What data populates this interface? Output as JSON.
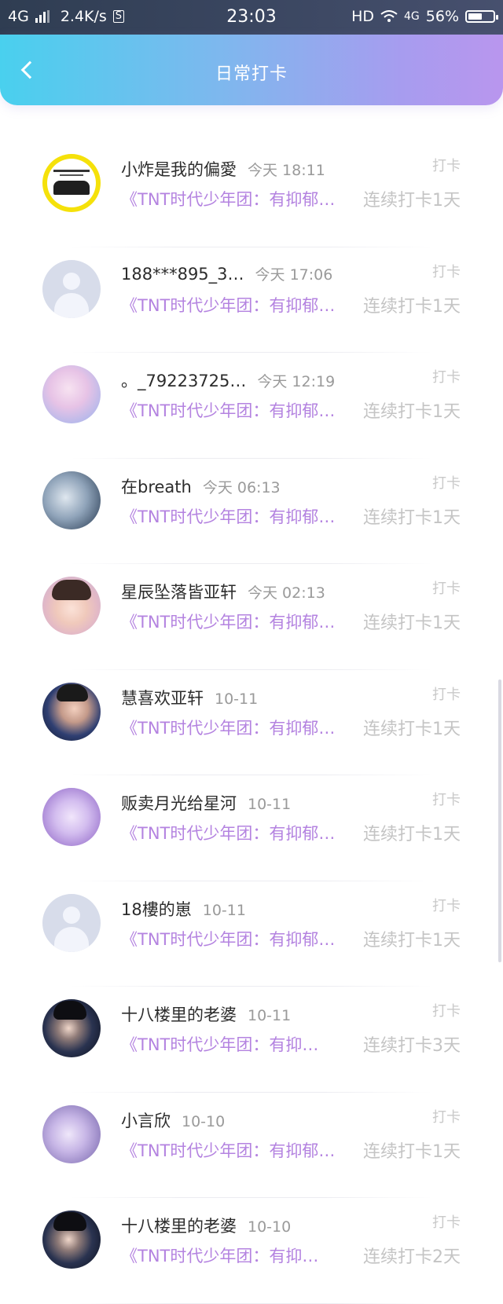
{
  "status_bar": {
    "network": "4G",
    "speed": "2.4K/s",
    "sim_badge": "S",
    "time": "23:03",
    "hd": "HD",
    "network2": "4G",
    "battery_percent": "56%",
    "battery_level": 0.56
  },
  "header": {
    "title": "日常打卡"
  },
  "items": [
    {
      "name": "小炸是我的偏愛",
      "time": "今天 18:11",
      "action": "打卡",
      "topic": "《TNT时代少年团：有抑郁…",
      "streak": "连续打卡1天",
      "avatar": "yellow"
    },
    {
      "name": "188***895_3…",
      "time": "今天 17:06",
      "action": "打卡",
      "topic": "《TNT时代少年团：有抑郁…",
      "streak": "连续打卡1天",
      "avatar": "default"
    },
    {
      "name": "。_79223725…",
      "time": "今天 12:19",
      "action": "打卡",
      "topic": "《TNT时代少年团：有抑郁…",
      "streak": "连续打卡1天",
      "avatar": "anime1"
    },
    {
      "name": "在breath",
      "time": "今天 06:13",
      "action": "打卡",
      "topic": "《TNT时代少年团：有抑郁…",
      "streak": "连续打卡1天",
      "avatar": "anime2"
    },
    {
      "name": "星辰坠落皆亚轩",
      "time": "今天 02:13",
      "action": "打卡",
      "topic": "《TNT时代少年团：有抑郁…",
      "streak": "连续打卡1天",
      "avatar": "boy1"
    },
    {
      "name": "慧喜欢亚轩",
      "time": "10-11",
      "action": "打卡",
      "topic": "《TNT时代少年团：有抑郁…",
      "streak": "连续打卡1天",
      "avatar": "boy2"
    },
    {
      "name": "贩卖月光给星河",
      "time": "10-11",
      "action": "打卡",
      "topic": "《TNT时代少年团：有抑郁…",
      "streak": "连续打卡1天",
      "avatar": "purple"
    },
    {
      "name": "18樓的崽",
      "time": "10-11",
      "action": "打卡",
      "topic": "《TNT时代少年团：有抑郁…",
      "streak": "连续打卡1天",
      "avatar": "default"
    },
    {
      "name": "十八楼里的老婆",
      "time": "10-11",
      "action": "打卡",
      "topic": "《TNT时代少年团：有抑…",
      "streak": "连续打卡3天",
      "avatar": "dark"
    },
    {
      "name": "小言欣",
      "time": "10-10",
      "action": "打卡",
      "topic": "《TNT时代少年团：有抑郁…",
      "streak": "连续打卡1天",
      "avatar": "lav"
    },
    {
      "name": "十八楼里的老婆",
      "time": "10-10",
      "action": "打卡",
      "topic": "《TNT时代少年团：有抑…",
      "streak": "连续打卡2天",
      "avatar": "dark"
    }
  ]
}
